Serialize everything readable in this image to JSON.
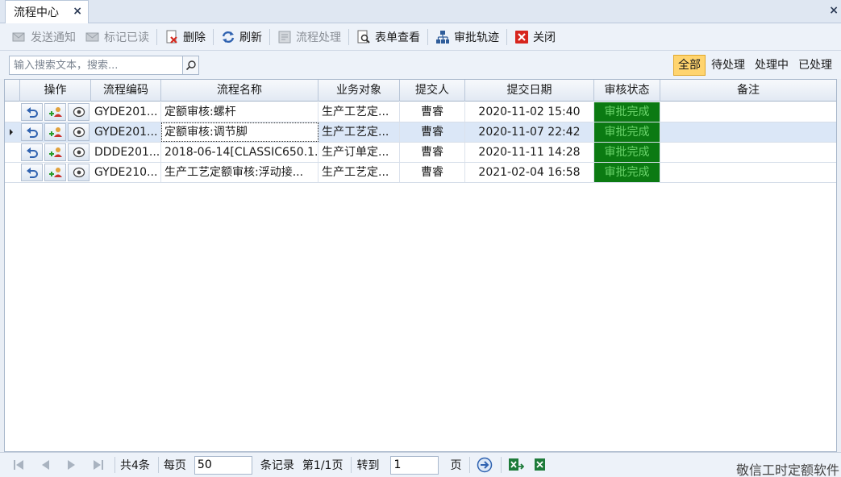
{
  "tabs": {
    "title": "流程中心",
    "close": "×",
    "window_close": "×"
  },
  "toolbar": {
    "send_notice": "发送通知",
    "mark_read": "标记已读",
    "delete": "删除",
    "refresh": "刷新",
    "process": "流程处理",
    "view_form": "表单查看",
    "approval_track": "审批轨迹",
    "close": "关闭"
  },
  "search": {
    "placeholder": "输入搜索文本，搜索..."
  },
  "filters": [
    "全部",
    "待处理",
    "处理中",
    "已处理"
  ],
  "columns": {
    "ops": "操作",
    "code": "流程编码",
    "name": "流程名称",
    "object": "业务对象",
    "submitter": "提交人",
    "date": "提交日期",
    "status": "审核状态",
    "remark": "备注"
  },
  "rows": [
    {
      "code": "GYDE201...",
      "name": "定额审核:螺杆",
      "object": "生产工艺定...",
      "submitter": "曹睿",
      "date": "2020-11-02 15:40",
      "status": "审批完成",
      "remark": ""
    },
    {
      "code": "GYDE201...",
      "name": "定额审核:调节脚",
      "object": "生产工艺定...",
      "submitter": "曹睿",
      "date": "2020-11-07 22:42",
      "status": "审批完成",
      "remark": ""
    },
    {
      "code": "DDDE201...",
      "name": "2018-06-14[CLASSIC650.1...",
      "object": "生产订单定...",
      "submitter": "曹睿",
      "date": "2020-11-11 14:28",
      "status": "审批完成",
      "remark": ""
    },
    {
      "code": "GYDE210...",
      "name": "生产工艺定额审核:浮动接...",
      "object": "生产工艺定...",
      "submitter": "曹睿",
      "date": "2021-02-04 16:58",
      "status": "审批完成",
      "remark": ""
    }
  ],
  "pager": {
    "total": "共4条",
    "per_page": "每页",
    "per_page_value": "50",
    "records": "条记录",
    "page_info": "第1/1页",
    "goto": "转到",
    "goto_value": "1",
    "page": "页"
  },
  "brand": "敬信工时定额软件",
  "colors": {
    "status_bg": "#0b7a12",
    "status_text": "#6bd46b",
    "filter_active": "#ffd46e"
  },
  "icons": [
    "send-icon",
    "mail-icon",
    "delete-icon",
    "refresh-icon",
    "process-icon",
    "form-view-icon",
    "org-chart-icon",
    "close-icon",
    "search-icon",
    "undo-icon",
    "assign-icon",
    "view-icon",
    "first-page-icon",
    "prev-page-icon",
    "next-page-icon",
    "last-page-icon",
    "go-icon",
    "excel-export-icon",
    "excel-icon"
  ]
}
